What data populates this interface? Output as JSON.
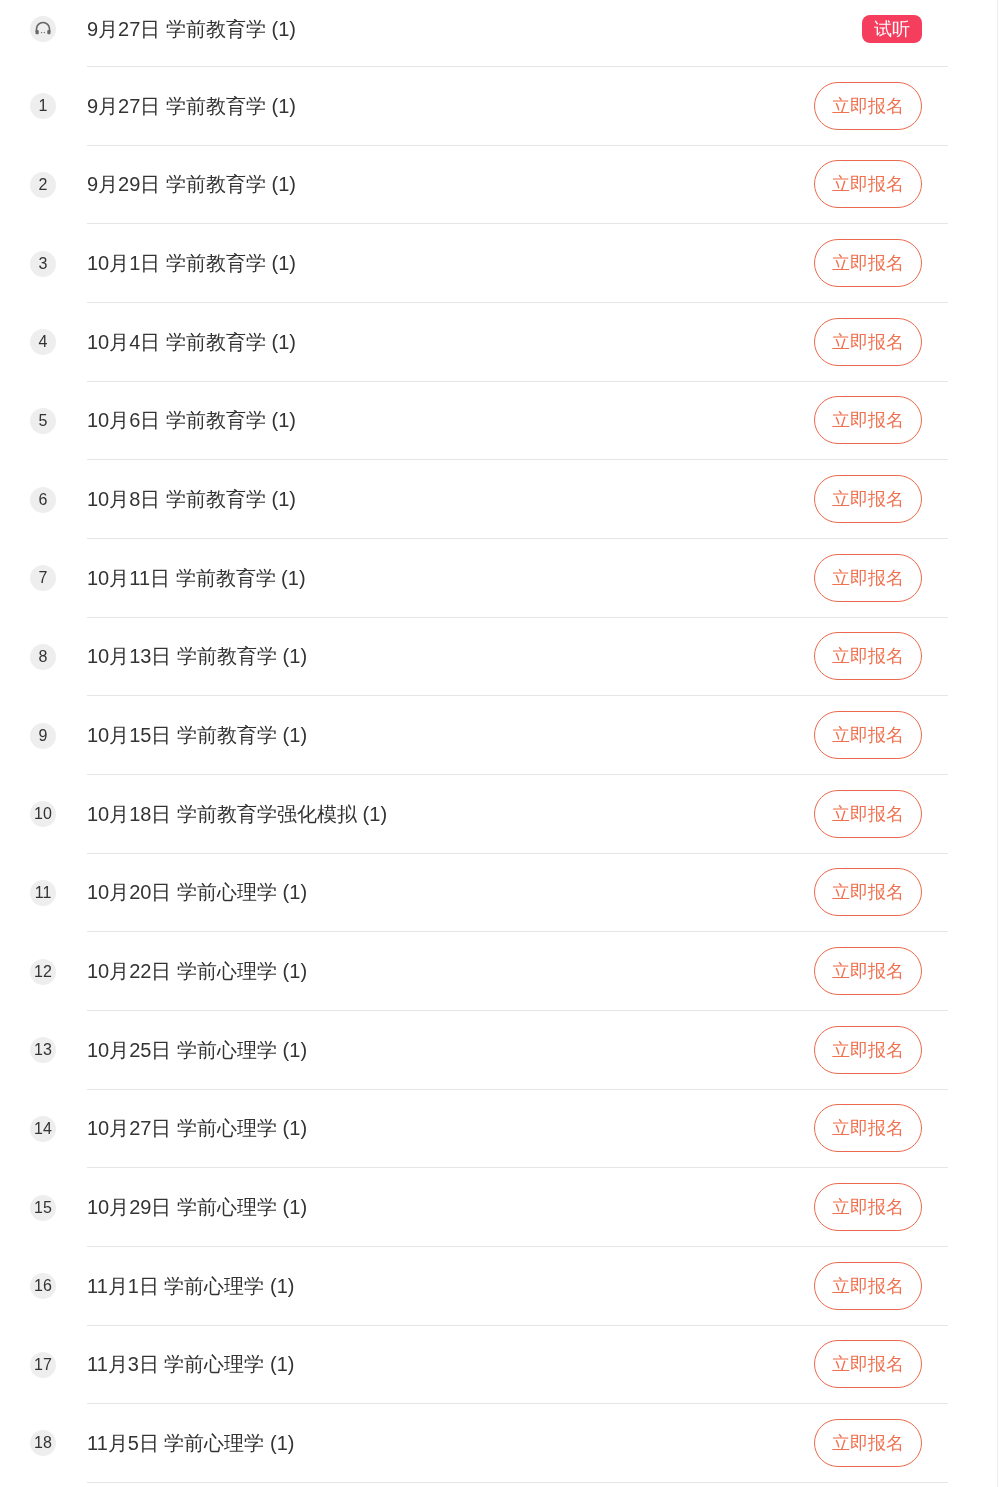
{
  "lessons": [
    {
      "kind": "trial",
      "title": "9月27日 学前教育学 (1)",
      "badge": "试听"
    },
    {
      "kind": "numbered",
      "index": "1",
      "title": "9月27日 学前教育学 (1)",
      "button": "立即报名"
    },
    {
      "kind": "numbered",
      "index": "2",
      "title": "9月29日 学前教育学 (1)",
      "button": "立即报名"
    },
    {
      "kind": "numbered",
      "index": "3",
      "title": "10月1日 学前教育学 (1)",
      "button": "立即报名"
    },
    {
      "kind": "numbered",
      "index": "4",
      "title": "10月4日 学前教育学 (1)",
      "button": "立即报名"
    },
    {
      "kind": "numbered",
      "index": "5",
      "title": "10月6日 学前教育学 (1)",
      "button": "立即报名"
    },
    {
      "kind": "numbered",
      "index": "6",
      "title": "10月8日 学前教育学 (1)",
      "button": "立即报名"
    },
    {
      "kind": "numbered",
      "index": "7",
      "title": "10月11日 学前教育学 (1)",
      "button": "立即报名"
    },
    {
      "kind": "numbered",
      "index": "8",
      "title": "10月13日 学前教育学 (1)",
      "button": "立即报名"
    },
    {
      "kind": "numbered",
      "index": "9",
      "title": "10月15日 学前教育学 (1)",
      "button": "立即报名"
    },
    {
      "kind": "numbered",
      "index": "10",
      "title": "10月18日 学前教育学强化模拟 (1)",
      "button": "立即报名"
    },
    {
      "kind": "numbered",
      "index": "11",
      "title": "10月20日 学前心理学 (1)",
      "button": "立即报名"
    },
    {
      "kind": "numbered",
      "index": "12",
      "title": "10月22日 学前心理学 (1)",
      "button": "立即报名"
    },
    {
      "kind": "numbered",
      "index": "13",
      "title": "10月25日 学前心理学 (1)",
      "button": "立即报名"
    },
    {
      "kind": "numbered",
      "index": "14",
      "title": "10月27日 学前心理学 (1)",
      "button": "立即报名"
    },
    {
      "kind": "numbered",
      "index": "15",
      "title": "10月29日 学前心理学 (1)",
      "button": "立即报名"
    },
    {
      "kind": "numbered",
      "index": "16",
      "title": "11月1日 学前心理学 (1)",
      "button": "立即报名"
    },
    {
      "kind": "numbered",
      "index": "17",
      "title": "11月3日 学前心理学 (1)",
      "button": "立即报名"
    },
    {
      "kind": "numbered",
      "index": "18",
      "title": "11月5日 学前心理学 (1)",
      "button": "立即报名"
    }
  ]
}
